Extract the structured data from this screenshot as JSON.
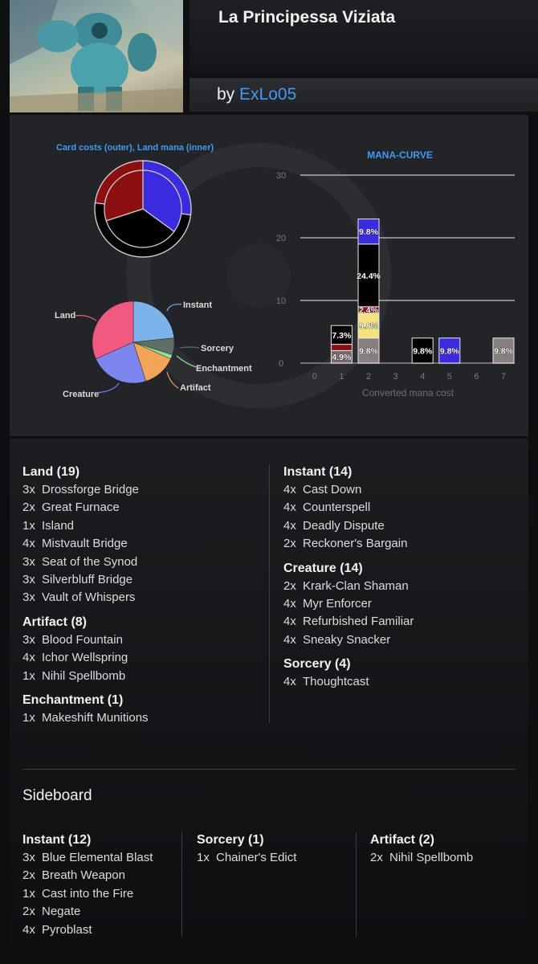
{
  "deck": {
    "title": "La Principessa Viziata",
    "by_prefix": "by",
    "author": "ExLo05"
  },
  "stats": {
    "pie1_label": "Card costs (outer), Land mana (inner)",
    "curve_title": "MANA-CURVE",
    "type_labels": {
      "land": "Land",
      "instant": "Instant",
      "sorcery": "Sorcery",
      "enchantment": "Enchantment",
      "artifact": "Artifact",
      "creature": "Creature"
    }
  },
  "chart_data": [
    {
      "type": "pie",
      "title": "Card costs (outer), Land mana (inner)",
      "series": [
        {
          "name": "outer",
          "labels": [
            "blue",
            "black",
            "red"
          ],
          "values": [
            0.27,
            0.5,
            0.23
          ],
          "colors": [
            "#3a2be0",
            "#000000",
            "#8b0f0f"
          ]
        },
        {
          "name": "inner",
          "labels": [
            "blue",
            "black",
            "red"
          ],
          "values": [
            0.35,
            0.35,
            0.3
          ],
          "colors": [
            "#3a2be0",
            "#000000",
            "#8b0f0f"
          ]
        }
      ]
    },
    {
      "type": "pie",
      "labels": [
        "Instant",
        "Sorcery",
        "Enchantment",
        "Artifact",
        "Creature",
        "Land"
      ],
      "values": [
        14,
        4,
        1,
        8,
        14,
        19
      ],
      "colors": [
        "#7ab4ea",
        "#5f6e66",
        "#8ce69a",
        "#f3a456",
        "#7c86ee",
        "#f05a80"
      ]
    },
    {
      "type": "bar",
      "title": "MANA-CURVE",
      "xlabel": "Converted mana cost",
      "categories": [
        "0",
        "1",
        "2",
        "3",
        "4",
        "5",
        "6",
        "7"
      ],
      "yticks": [
        "0",
        "10",
        "20",
        "30"
      ],
      "ylim": [
        0,
        30
      ],
      "stacks": [
        [],
        [
          {
            "value": 2,
            "color": "#7a6a6a",
            "label": "4.9%"
          },
          {
            "value": 1,
            "color": "#8b0f0f",
            "label": ""
          },
          {
            "value": 3,
            "color": "#000000",
            "label": "7.3%"
          }
        ],
        [
          {
            "value": 4,
            "color": "#888080",
            "label": "9.8%"
          },
          {
            "value": 4,
            "color": "#f4e27a",
            "label": "9.8%"
          },
          {
            "value": 1,
            "color": "#a01010",
            "label": "2.4%"
          },
          {
            "value": 10,
            "color": "#000000",
            "label": "24.4%"
          },
          {
            "value": 4,
            "color": "#3a2be0",
            "label": "9.8%"
          }
        ],
        [],
        [
          {
            "value": 4,
            "color": "#000000",
            "label": "9.8%"
          }
        ],
        [
          {
            "value": 4,
            "color": "#3a2be0",
            "label": "9.8%"
          }
        ],
        [],
        [
          {
            "value": 4,
            "color": "#888080",
            "label": "9.8%"
          }
        ]
      ]
    }
  ],
  "main": {
    "left": [
      {
        "title": "Land (19)",
        "cards": [
          {
            "qty": "3x",
            "name": "Drossforge Bridge"
          },
          {
            "qty": "2x",
            "name": "Great Furnace"
          },
          {
            "qty": "1x",
            "name": "Island"
          },
          {
            "qty": "4x",
            "name": "Mistvault Bridge"
          },
          {
            "qty": "3x",
            "name": "Seat of the Synod"
          },
          {
            "qty": "3x",
            "name": "Silverbluff Bridge"
          },
          {
            "qty": "3x",
            "name": "Vault of Whispers"
          }
        ]
      },
      {
        "title": "Artifact (8)",
        "cards": [
          {
            "qty": "3x",
            "name": "Blood Fountain"
          },
          {
            "qty": "4x",
            "name": "Ichor Wellspring"
          },
          {
            "qty": "1x",
            "name": "Nihil Spellbomb"
          }
        ]
      },
      {
        "title": "Enchantment (1)",
        "cards": [
          {
            "qty": "1x",
            "name": "Makeshift Munitions"
          }
        ]
      }
    ],
    "right": [
      {
        "title": "Instant (14)",
        "cards": [
          {
            "qty": "4x",
            "name": "Cast Down"
          },
          {
            "qty": "4x",
            "name": "Counterspell"
          },
          {
            "qty": "4x",
            "name": "Deadly Dispute"
          },
          {
            "qty": "2x",
            "name": "Reckoner's Bargain"
          }
        ]
      },
      {
        "title": "Creature (14)",
        "cards": [
          {
            "qty": "2x",
            "name": "Krark-Clan Shaman"
          },
          {
            "qty": "4x",
            "name": "Myr Enforcer"
          },
          {
            "qty": "4x",
            "name": "Refurbished Familiar"
          },
          {
            "qty": "4x",
            "name": "Sneaky Snacker"
          }
        ]
      },
      {
        "title": "Sorcery (4)",
        "cards": [
          {
            "qty": "4x",
            "name": "Thoughtcast"
          }
        ]
      }
    ]
  },
  "sideboard": {
    "title": "Sideboard",
    "columns": [
      {
        "title": "Instant (12)",
        "cards": [
          {
            "qty": "3x",
            "name": "Blue Elemental Blast"
          },
          {
            "qty": "2x",
            "name": "Breath Weapon"
          },
          {
            "qty": "1x",
            "name": "Cast into the Fire"
          },
          {
            "qty": "2x",
            "name": "Negate"
          },
          {
            "qty": "4x",
            "name": "Pyroblast"
          }
        ]
      },
      {
        "title": "Sorcery (1)",
        "cards": [
          {
            "qty": "1x",
            "name": "Chainer's Edict"
          }
        ]
      },
      {
        "title": "Artifact (2)",
        "cards": [
          {
            "qty": "2x",
            "name": "Nihil Spellbomb"
          }
        ]
      }
    ]
  }
}
